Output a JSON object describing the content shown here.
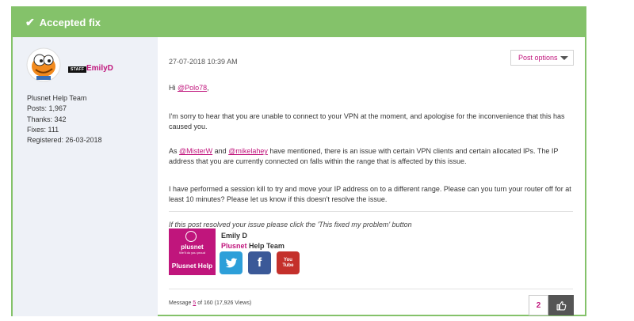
{
  "banner": {
    "icon": "checkmark-icon",
    "title": "Accepted fix"
  },
  "author": {
    "avatar_icon": "cartoon-avatar-icon",
    "staff_badge": "STAFF",
    "username": "EmilyD",
    "role": "Plusnet Help Team",
    "posts": "Posts: 1,967",
    "thanks": "Thanks: 342",
    "fixes": "Fixes: 111",
    "registered": "Registered: 26-03-2018"
  },
  "post": {
    "timestamp": "27-07-2018 10:39 AM",
    "options_label": "Post options",
    "greeting_prefix": "Hi ",
    "greeting_mention": "@Polo78",
    "greeting_suffix": ",",
    "para1": "I'm sorry to hear that you are unable to connect to your VPN at the moment, and apologise for the inconvenience that this has caused you.",
    "para2_prefix": "As ",
    "para2_mention1": "@MisterW",
    "para2_and": " and ",
    "para2_mention2": "@mikelahey",
    "para2_rest": " have mentioned, there is an issue with certain VPN clients and certain allocated IPs. The IP address that you are currently connected on falls within the range that is affected by this issue.",
    "para3": "I have performed a session kill to try and move your IP address on to a different range. Please can you turn your router off for at least 10 minutes? Please let us know if this doesn't resolve the issue."
  },
  "signature": {
    "note": "If this post resolved your issue please click the 'This fixed my problem' button",
    "logo_brand": "plusnet",
    "logo_tagline": "We'll do you proud",
    "logo_title": "Plusnet Help",
    "name": "Emily D",
    "team_brand": "Plusnet",
    "team_rest": " Help Team",
    "social": [
      {
        "icon": "twitter-icon",
        "glyph": "🐦"
      },
      {
        "icon": "facebook-icon",
        "glyph": "f"
      },
      {
        "icon": "youtube-icon",
        "glyph_top": "You",
        "glyph_bottom": "Tube"
      }
    ]
  },
  "footer": {
    "msg_prefix": "Message ",
    "msg_number": "5",
    "msg_suffix": " of 160 (17,926 Views)",
    "kudos_count": "2",
    "kudos_icon": "thumbs-up-icon"
  },
  "colors": {
    "accent_green": "#84c26a",
    "brand_pink": "#c0157c",
    "sidebar_bg": "#eef1f7"
  }
}
